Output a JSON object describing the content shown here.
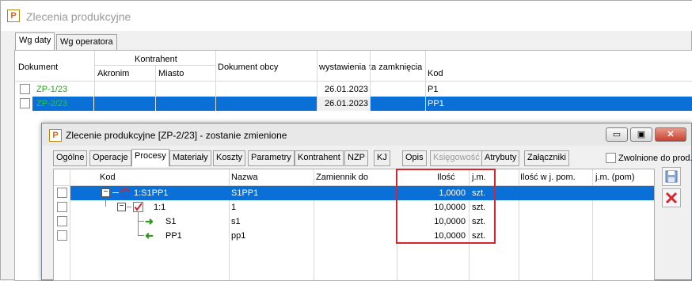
{
  "bg_window": {
    "title": "Zlecenia produkcyjne",
    "icon": "P",
    "tabs": [
      {
        "label": "Wg daty",
        "active": true
      },
      {
        "label": "Wg operatora",
        "active": false
      }
    ],
    "columns": {
      "dokument": "Dokument",
      "kontrahent": "Kontrahent",
      "akronim": "Akronim",
      "miasto": "Miasto",
      "dokument_obcy": "Dokument obcy",
      "wystawienia": "wystawienia",
      "zamkniecia": "ta zamknięcia",
      "kod": "Kod"
    },
    "rows": [
      {
        "dokument": "ZP-1/23",
        "wystawienia": "26.01.2023",
        "kod": "P1",
        "selected": false
      },
      {
        "dokument": "ZP-2/23",
        "wystawienia": "26.01.2023",
        "kod": "PP1",
        "selected": true
      }
    ],
    "doc_link_color": "#1aa31a"
  },
  "child_window": {
    "title": "Zlecenie produkcyjne  [ZP-2/23] - zostanie zmienione",
    "icon": "P",
    "buttons": {
      "minimize": "▭",
      "maximize": "▣",
      "close": "✕"
    },
    "tabs": [
      {
        "label": "Ogólne",
        "active": false,
        "disabled": false
      },
      {
        "label": "Operacje",
        "active": false,
        "disabled": false
      },
      {
        "label": "Procesy",
        "active": true,
        "disabled": false
      },
      {
        "label": "Materiały",
        "active": false,
        "disabled": false
      },
      {
        "label": "Koszty",
        "active": false,
        "disabled": false
      },
      {
        "label": "Parametry",
        "active": false,
        "disabled": false
      },
      {
        "label": "Kontrahent",
        "active": false,
        "disabled": false
      },
      {
        "label": "NZP",
        "active": false,
        "disabled": false
      },
      {
        "label": "KJ",
        "active": false,
        "disabled": false
      },
      {
        "label": "Opis",
        "active": false,
        "disabled": false
      },
      {
        "label": "Księgowość",
        "active": false,
        "disabled": true
      },
      {
        "label": "Atrybuty",
        "active": false,
        "disabled": false
      },
      {
        "label": "Załączniki",
        "active": false,
        "disabled": false
      }
    ],
    "zwolnione_label": "Zwolnione do prod.",
    "columns": {
      "kod": "Kod",
      "nazwa": "Nazwa",
      "zamiennik": "Zamiennik do",
      "ilosc": "Ilość",
      "jm": "j.m.",
      "ilosc_pom": "Ilość w j. pom.",
      "jm_pom": "j.m. (pom)"
    },
    "rows": [
      {
        "kod": "1:S1PP1",
        "nazwa": "S1PP1",
        "ilosc": "1,0000",
        "jm": "szt.",
        "icon": "cycle-icon",
        "selected": true
      },
      {
        "kod": "1:1",
        "nazwa": "1",
        "ilosc": "10,0000",
        "jm": "szt.",
        "icon": "check-icon",
        "selected": false
      },
      {
        "kod": "S1",
        "nazwa": "s1",
        "ilosc": "10,0000",
        "jm": "szt.",
        "icon": "arrow-right-icon",
        "selected": false
      },
      {
        "kod": "PP1",
        "nazwa": "pp1",
        "ilosc": "10,0000",
        "jm": "szt.",
        "icon": "arrow-left-icon",
        "selected": false
      }
    ],
    "highlight_color": "#d9232d"
  }
}
